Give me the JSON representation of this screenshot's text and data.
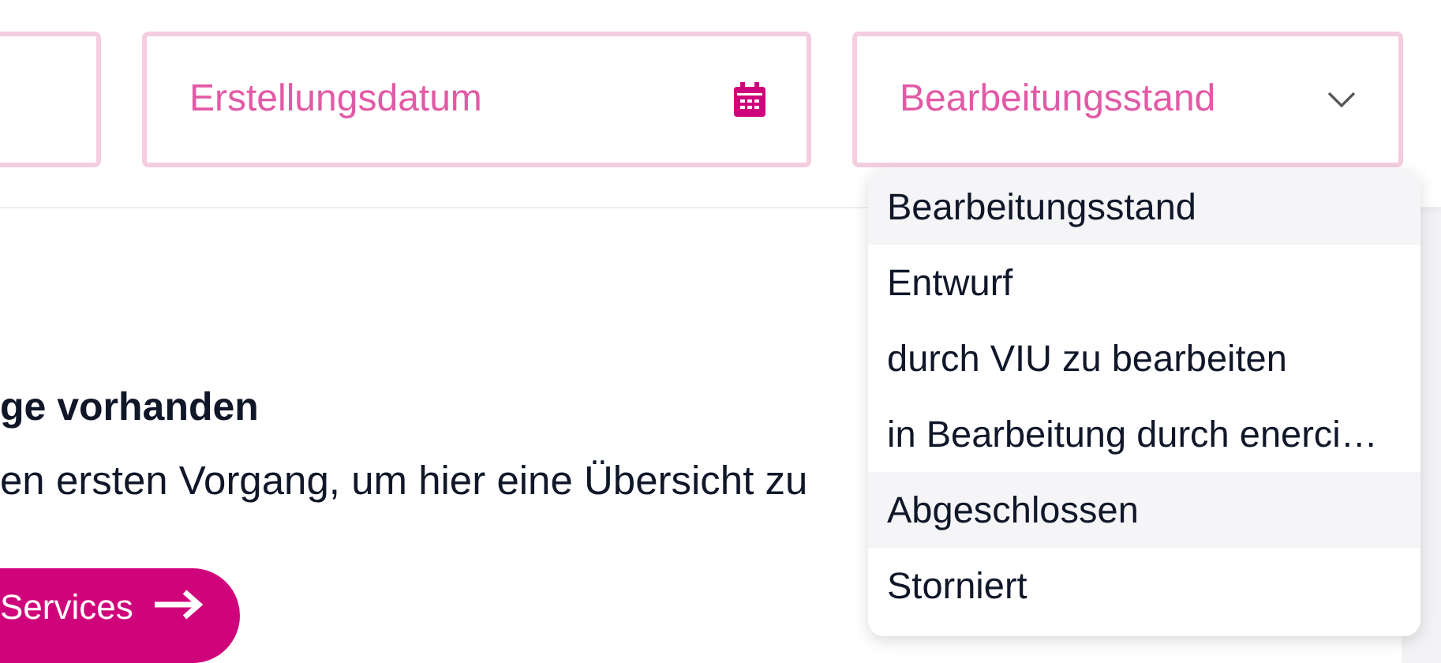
{
  "filters": [
    {
      "kind": "text"
    },
    {
      "kind": "date",
      "placeholder": "Erstellungsdatum"
    },
    {
      "kind": "select",
      "placeholder": "Bearbeitungsstand",
      "expanded": true
    }
  ],
  "dropdown": {
    "options": [
      {
        "label": "Bearbeitungsstand",
        "highlighted": true
      },
      {
        "label": "Entwurf",
        "highlighted": false
      },
      {
        "label": "durch VIU zu bearbeiten",
        "highlighted": false
      },
      {
        "label": "in Bearbeitung durch enerci…",
        "highlighted": false
      },
      {
        "label": "Abgeschlossen",
        "highlighted": true
      },
      {
        "label": "Storniert",
        "highlighted": false
      }
    ]
  },
  "empty_state": {
    "heading": "ge vorhanden",
    "text": "en ersten Vorgang, um hier eine Übersicht zu",
    "button": "Services"
  }
}
